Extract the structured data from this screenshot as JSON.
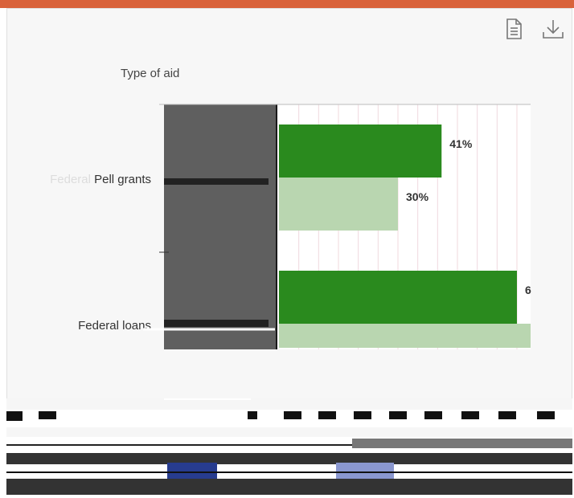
{
  "toolbar": {
    "icons": [
      "document-icon",
      "download-icon"
    ]
  },
  "chart_data": {
    "type": "bar",
    "orientation": "horizontal",
    "ylabel": "Type of aid",
    "categories": [
      "Federal Pell grants",
      "Federal loans"
    ],
    "series": [
      {
        "values": [
          41,
          60
        ],
        "labels": [
          "41%",
          "6"
        ],
        "color": "#2a8a1e"
      },
      {
        "values": [
          30,
          null
        ],
        "labels": [
          "30%",
          ""
        ],
        "color": "#b9d6b0"
      }
    ],
    "xlim": [
      0,
      70
    ],
    "grid": true
  },
  "colors": {
    "accent": "#d9623b",
    "dark_series": "#2a8a1e",
    "light_series": "#b9d6b0",
    "occluder": "#5f5f5f"
  }
}
